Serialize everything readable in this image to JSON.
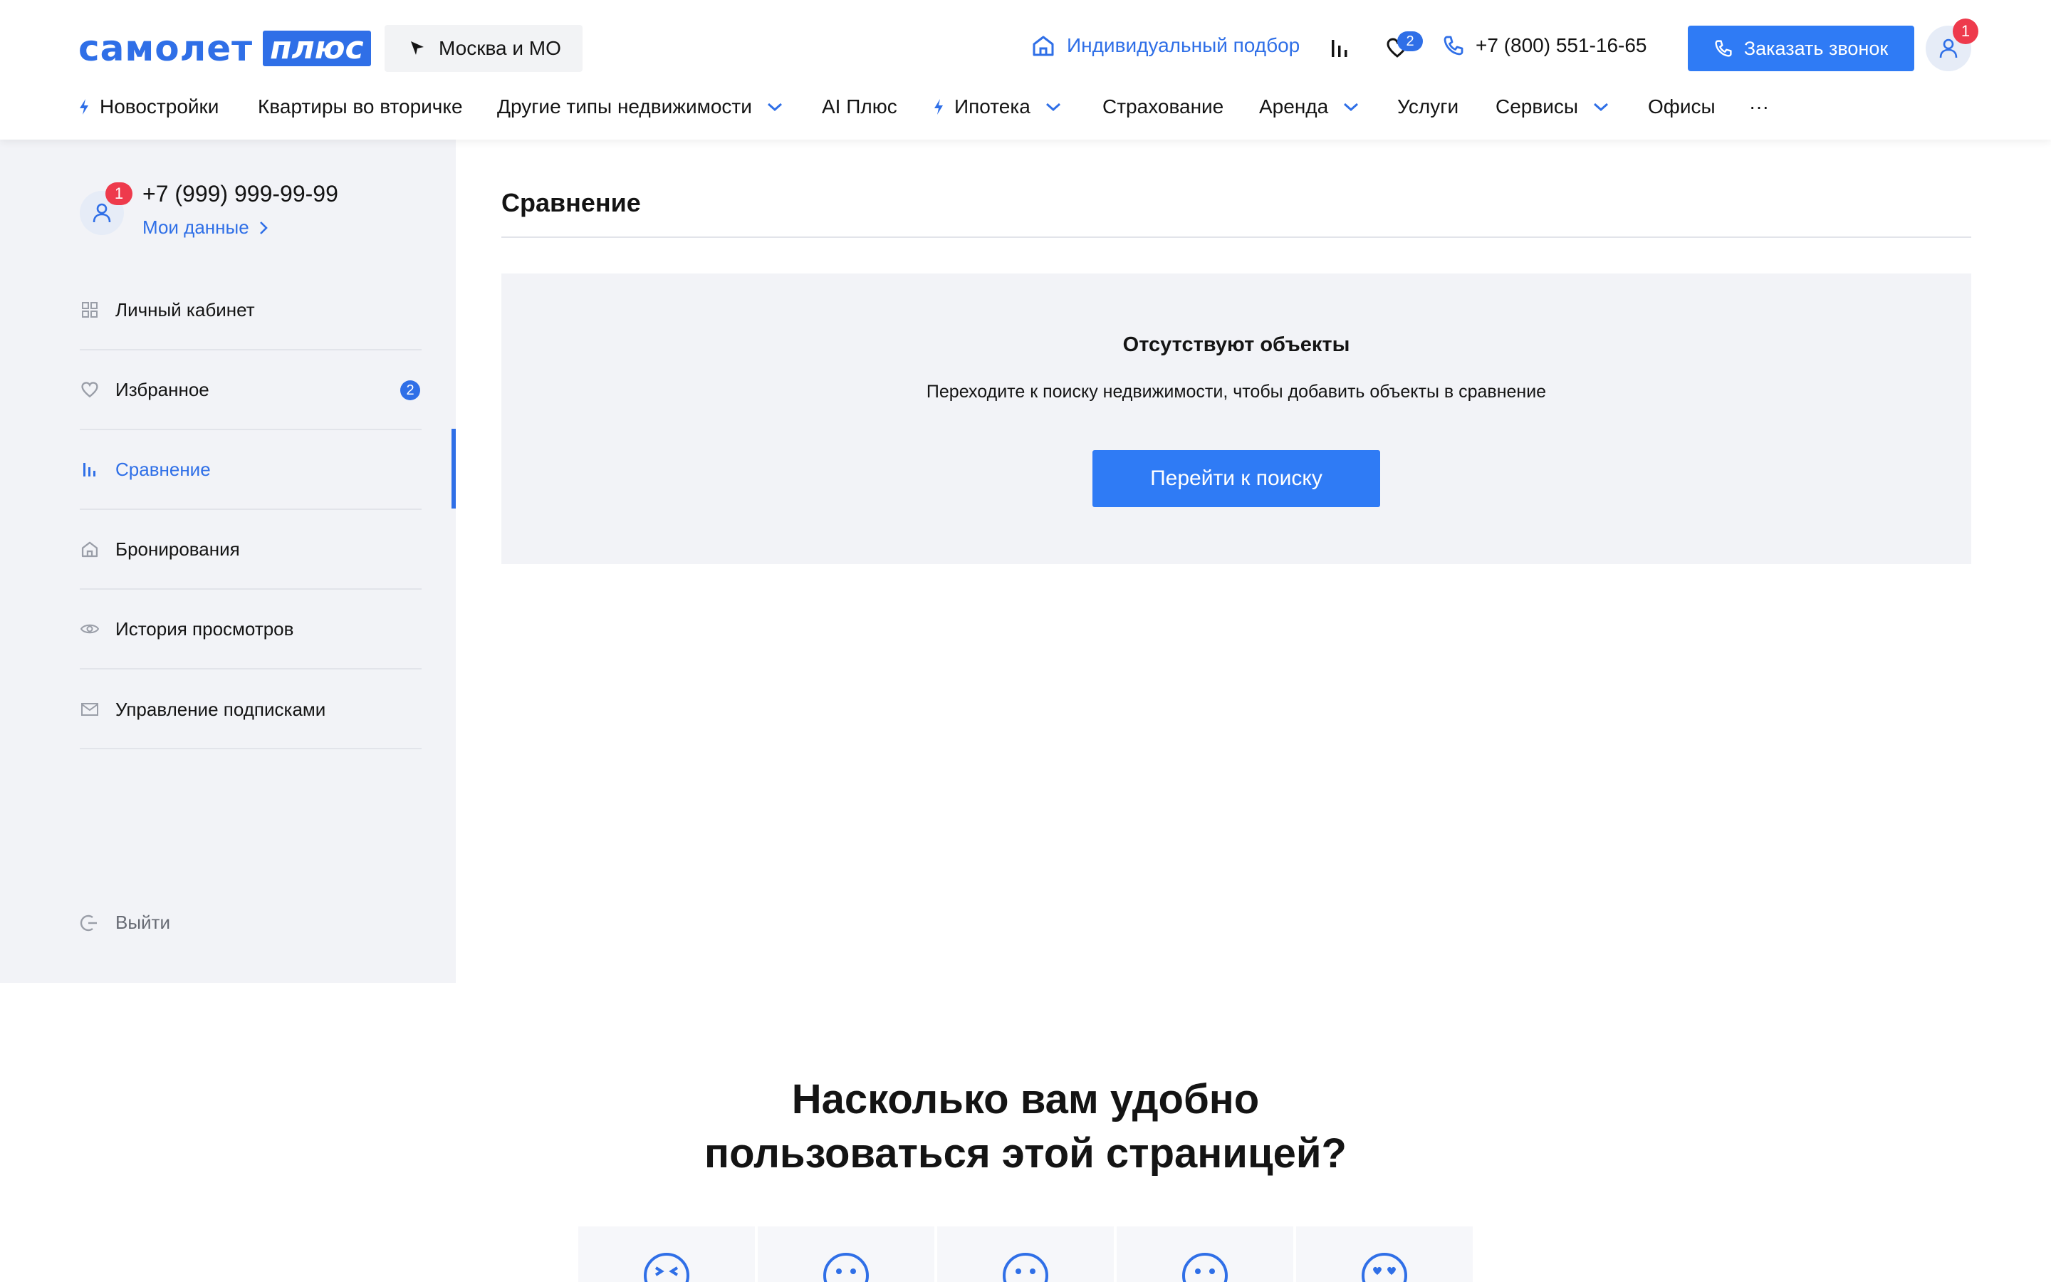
{
  "header": {
    "logo_word": "самолет",
    "logo_plus": "плюс",
    "city": "Москва и МО",
    "individual_selection": "Индивидуальный подбор",
    "favorites_count": "2",
    "phone": "+7 (800) 551-16-65",
    "call_button": "Заказать звонок",
    "profile_notifications": "1"
  },
  "nav": {
    "items": [
      "Новостройки",
      "Квартиры во вторичке",
      "Другие типы недвижимости",
      "AI Плюс",
      "Ипотека",
      "Страхование",
      "Аренда",
      "Услуги",
      "Сервисы",
      "Офисы"
    ],
    "more": "···"
  },
  "sidebar": {
    "notifications": "1",
    "phone": "+7 (999) 999-99-99",
    "my_data": "Мои данные",
    "items": [
      {
        "label": "Личный кабинет",
        "icon": "grid-icon"
      },
      {
        "label": "Избранное",
        "icon": "heart-icon",
        "count": "2"
      },
      {
        "label": "Сравнение",
        "icon": "bars-icon",
        "active": true
      },
      {
        "label": "Бронирования",
        "icon": "house-icon"
      },
      {
        "label": "История просмотров",
        "icon": "eye-icon"
      },
      {
        "label": "Управление подписками",
        "icon": "mail-icon"
      }
    ],
    "logout": "Выйти"
  },
  "main": {
    "title": "Сравнение",
    "empty_title": "Отсутствуют объекты",
    "empty_text": "Переходите к поиску недвижимости, чтобы добавить объекты в сравнение",
    "search_button": "Перейти к поиску"
  },
  "feedback": {
    "title_line1": "Насколько вам удобно",
    "title_line2": "пользоваться этой страницей?",
    "options": [
      "very-dissatisfied-icon",
      "sad-icon",
      "neutral-icon",
      "slightly-happy-icon",
      "love-icon"
    ]
  },
  "colors": {
    "accent": "#2f7bf5",
    "brand": "#2f6fe7",
    "badge_red": "#ee3a4c",
    "sidebar_bg": "#f2f3f7"
  }
}
